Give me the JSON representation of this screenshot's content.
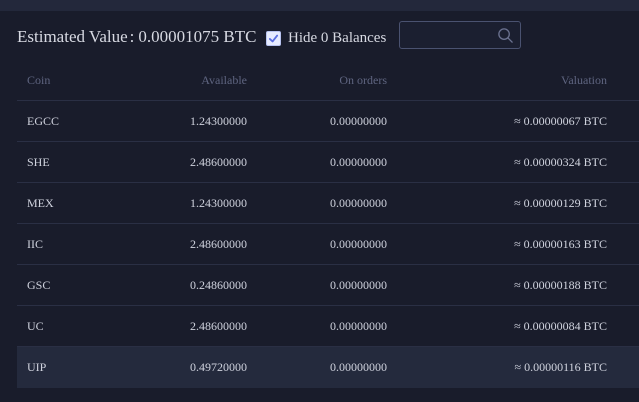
{
  "summary": {
    "label": "Estimated Value",
    "colon": ":",
    "value": "0.00001075 BTC"
  },
  "filter": {
    "hide_zero_label": "Hide 0 Balances",
    "hide_zero_checked": true
  },
  "search": {
    "placeholder": "",
    "value": ""
  },
  "table": {
    "headers": {
      "coin": "Coin",
      "available": "Available",
      "on_orders": "On orders",
      "valuation": "Valuation"
    },
    "rows": [
      {
        "coin": "EGCC",
        "available": "1.24300000",
        "on_orders": "0.00000000",
        "valuation": "≈ 0.00000067 BTC"
      },
      {
        "coin": "SHE",
        "available": "2.48600000",
        "on_orders": "0.00000000",
        "valuation": "≈ 0.00000324 BTC"
      },
      {
        "coin": "MEX",
        "available": "1.24300000",
        "on_orders": "0.00000000",
        "valuation": "≈ 0.00000129 BTC"
      },
      {
        "coin": "IIC",
        "available": "2.48600000",
        "on_orders": "0.00000000",
        "valuation": "≈ 0.00000163 BTC"
      },
      {
        "coin": "GSC",
        "available": "0.24860000",
        "on_orders": "0.00000000",
        "valuation": "≈ 0.00000188 BTC"
      },
      {
        "coin": "UC",
        "available": "2.48600000",
        "on_orders": "0.00000000",
        "valuation": "≈ 0.00000084 BTC"
      },
      {
        "coin": "UIP",
        "available": "0.49720000",
        "on_orders": "0.00000000",
        "valuation": "≈ 0.00000116 BTC"
      }
    ]
  },
  "colors": {
    "background": "#191c2b",
    "row_highlight": "#242a3d",
    "checkbox_accent": "#5b6ee0"
  },
  "icons": {
    "checkbox": "checkmark-icon",
    "search": "search-icon"
  }
}
